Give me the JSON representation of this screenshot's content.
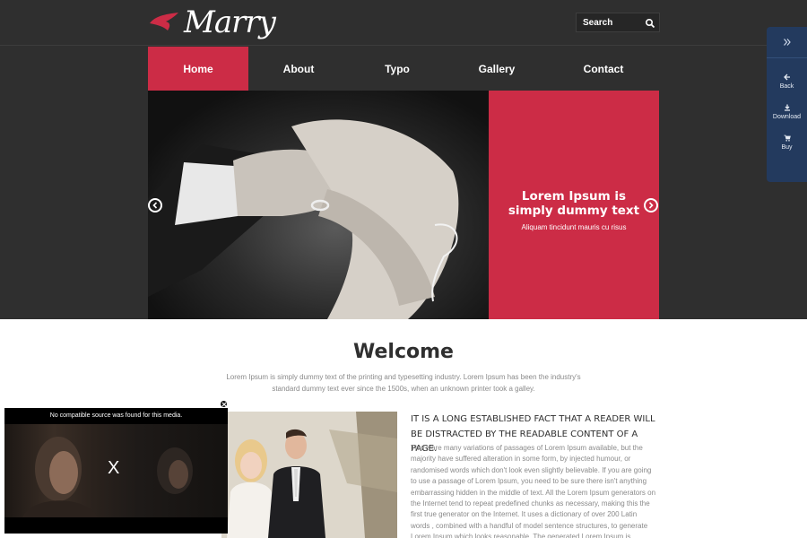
{
  "brand": {
    "name": "Marry",
    "accent": "#cc2c46",
    "dark": "#2f2f2f",
    "panel": "#233a5e"
  },
  "search": {
    "placeholder": "Search",
    "icon": "search-icon"
  },
  "nav": {
    "items": [
      {
        "label": "Home",
        "active": true
      },
      {
        "label": "About",
        "active": false
      },
      {
        "label": "Typo",
        "active": false
      },
      {
        "label": "Gallery",
        "active": false
      },
      {
        "label": "Contact",
        "active": false
      }
    ]
  },
  "slider": {
    "caption_title": "Lorem Ipsum is simply dummy text",
    "caption_sub": "Aliquam tincidunt mauris cu risus"
  },
  "side_panel": {
    "items": [
      {
        "label": "Back",
        "icon": "arrow-left-icon"
      },
      {
        "label": "Download",
        "icon": "download-icon"
      },
      {
        "label": "Buy",
        "icon": "cart-icon"
      }
    ]
  },
  "welcome": {
    "title": "Welcome",
    "text": "Lorem Ipsum is simply dummy text of the printing and typesetting industry. Lorem Ipsum has been the industry's standard dummy text ever since the 1500s, when an unknown printer took a galley."
  },
  "article": {
    "heading": "It is a long established fact that a reader will be distracted by the readable content of a page.",
    "body": "There are many variations of passages of Lorem Ipsum available, but the majority have suffered alteration in some form, by injected humour, or randomised words which don't look even slightly believable. If you are going to use a passage of Lorem Ipsum, you need to be sure there isn't anything embarrassing hidden in the middle of text. All the Lorem Ipsum generators on the Internet tend to repeat predefined chunks as necessary, making this the first true generator on the Internet. It uses a dictionary of over 200 Latin words , combined with a handful of model sentence structures, to generate Lorem Ipsum which looks reasonable. The generated Lorem Ipsum is"
  },
  "video": {
    "message": "No compatible source was found for this media.",
    "close_label": "X"
  }
}
